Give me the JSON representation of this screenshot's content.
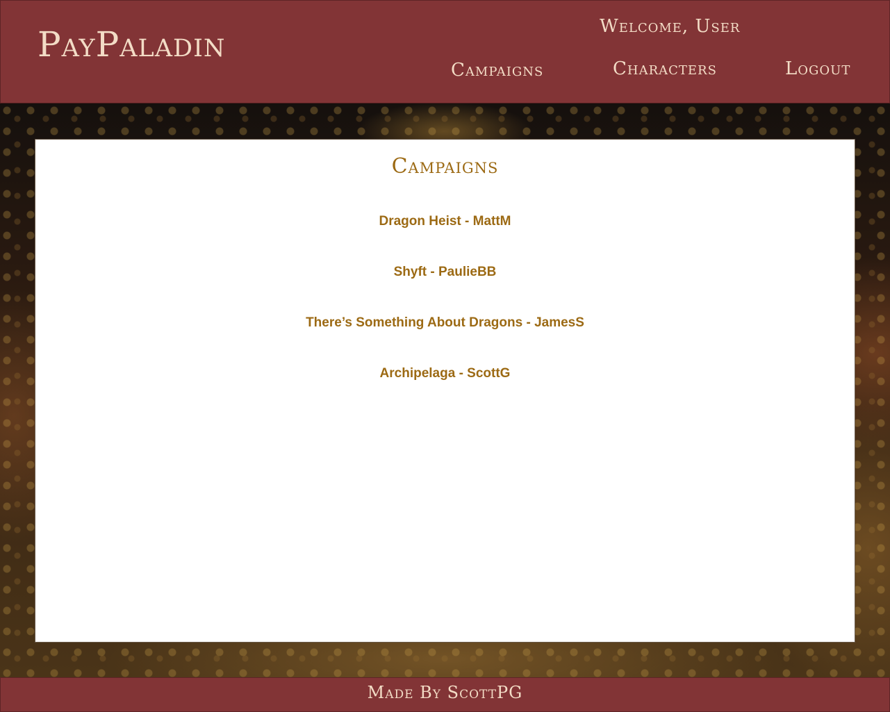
{
  "header": {
    "brand": "PayPaladin",
    "welcome": "Welcome, User",
    "nav": {
      "campaigns": "Campaigns",
      "characters": "Characters",
      "logout": "Logout"
    }
  },
  "main": {
    "title": "Campaigns",
    "campaigns": [
      "Dragon Heist - MattM",
      "Shyft - PaulieBB",
      "There’s Something About Dragons - JamesS",
      "Archipelaga - ScottG"
    ]
  },
  "footer": {
    "text": "Made By ScottPG"
  },
  "colors": {
    "header_bg": "#823436",
    "header_text": "#f3dcc6",
    "accent_gold": "#9c6a14",
    "panel_bg": "#ffffff"
  }
}
